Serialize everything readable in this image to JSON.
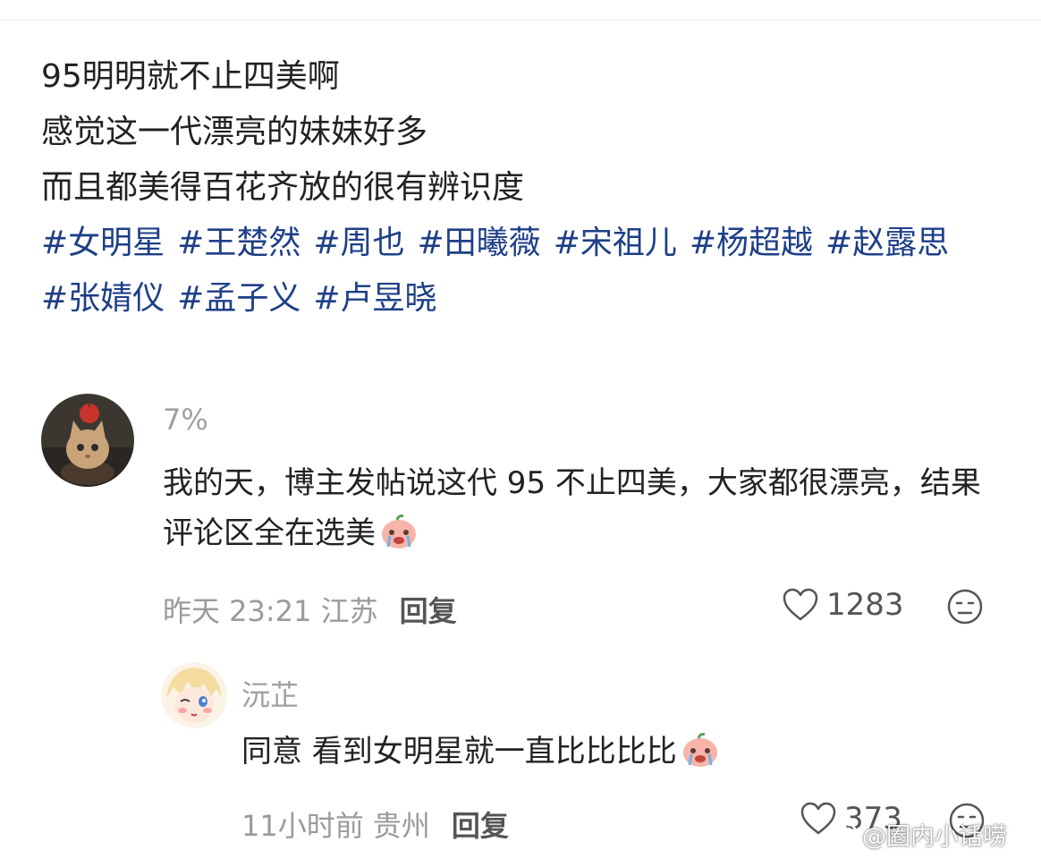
{
  "post": {
    "lines": [
      "95明明就不止四美啊",
      "感觉这一代漂亮的妹妹好多",
      "而且都美得百花齐放的很有辨识度"
    ],
    "tags": [
      "#女明星",
      "#王楚然",
      "#周也",
      "#田曦薇",
      "#宋祖儿",
      "#杨超越",
      "#赵露思",
      "#张婧仪",
      "#孟子义",
      "#卢昱晓"
    ]
  },
  "comments": [
    {
      "username": "7%",
      "content": "我的天，博主发帖说这代 95 不止四美，大家都很漂亮，结果评论区全在选美",
      "time": "昨天 23:21 江苏",
      "reply_label": "回复",
      "likes": "1283"
    },
    {
      "username": "沅芷",
      "content": "同意 看到女明星就一直比比比比",
      "time": "11小时前 贵州",
      "reply_label": "回复",
      "likes": "373"
    }
  ],
  "watermark": "@圈内小话唠",
  "colors": {
    "tag": "#1e3f88",
    "text": "#222222",
    "meta": "#9a9a9a"
  }
}
